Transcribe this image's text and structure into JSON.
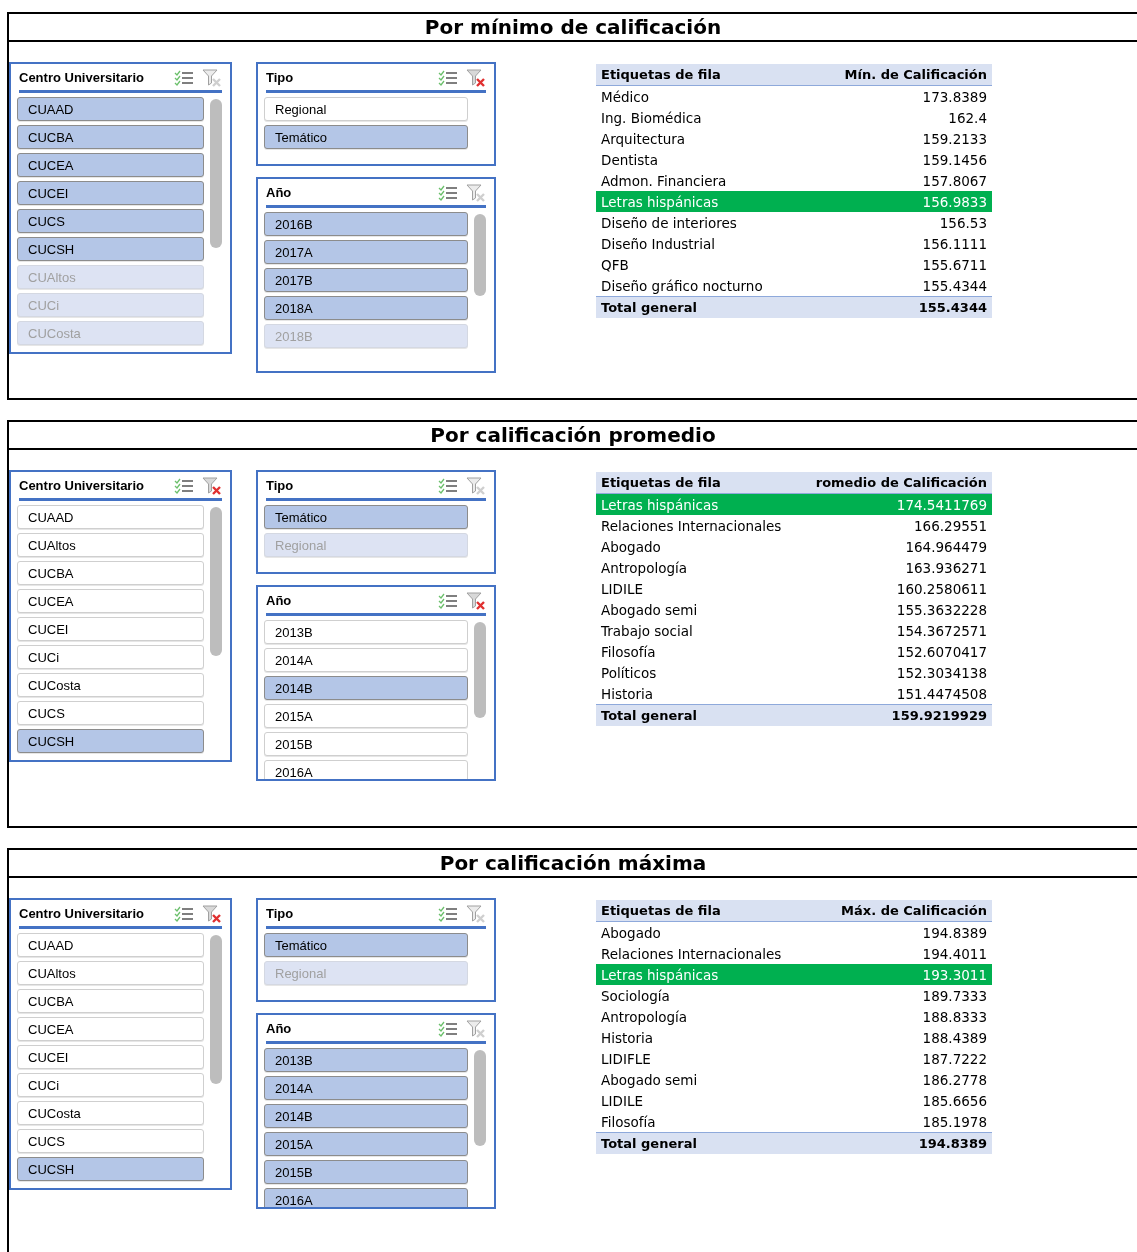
{
  "sections": [
    {
      "title": "Por mínimo de calificación",
      "slicers": [
        {
          "title": "Centro Universitario",
          "filter_active": false,
          "items": [
            {
              "label": "CUAAD",
              "selected": true,
              "disabled": false
            },
            {
              "label": "CUCBA",
              "selected": true,
              "disabled": false
            },
            {
              "label": "CUCEA",
              "selected": true,
              "disabled": false
            },
            {
              "label": "CUCEI",
              "selected": true,
              "disabled": false
            },
            {
              "label": "CUCS",
              "selected": true,
              "disabled": false
            },
            {
              "label": "CUCSH",
              "selected": true,
              "disabled": false
            },
            {
              "label": "CUAltos",
              "selected": true,
              "disabled": true
            },
            {
              "label": "CUCi",
              "selected": true,
              "disabled": true
            },
            {
              "label": "CUCosta",
              "selected": true,
              "disabled": true
            }
          ]
        },
        {
          "title": "Tipo",
          "filter_active": true,
          "items": [
            {
              "label": "Regional",
              "selected": false,
              "disabled": false
            },
            {
              "label": "Temático",
              "selected": true,
              "disabled": false
            }
          ]
        },
        {
          "title": "Año",
          "filter_active": false,
          "items": [
            {
              "label": "2016B",
              "selected": true,
              "disabled": false
            },
            {
              "label": "2017A",
              "selected": true,
              "disabled": false
            },
            {
              "label": "2017B",
              "selected": true,
              "disabled": false
            },
            {
              "label": "2018A",
              "selected": true,
              "disabled": false
            },
            {
              "label": "2018B",
              "selected": true,
              "disabled": true
            }
          ]
        }
      ],
      "table": {
        "columns": [
          "Etiquetas de fila",
          "Mín. de Calificación"
        ],
        "rows": [
          {
            "label": "Médico",
            "value": "173.8389",
            "highlighted": false
          },
          {
            "label": "Ing. Biomédica",
            "value": "162.4",
            "highlighted": false
          },
          {
            "label": "Arquitectura",
            "value": "159.2133",
            "highlighted": false
          },
          {
            "label": "Dentista",
            "value": "159.1456",
            "highlighted": false
          },
          {
            "label": "Admon. Financiera",
            "value": "157.8067",
            "highlighted": false
          },
          {
            "label": "Letras hispánicas",
            "value": "156.9833",
            "highlighted": true
          },
          {
            "label": "Diseño de interiores",
            "value": "156.53",
            "highlighted": false
          },
          {
            "label": "Diseño Industrial",
            "value": "156.1111",
            "highlighted": false
          },
          {
            "label": "QFB",
            "value": "155.6711",
            "highlighted": false
          },
          {
            "label": "Diseño gráfico nocturno",
            "value": "155.4344",
            "highlighted": false
          }
        ],
        "total": {
          "label": "Total general",
          "value": "155.4344"
        }
      }
    },
    {
      "title": "Por calificación promedio",
      "slicers": [
        {
          "title": "Centro Universitario",
          "filter_active": true,
          "items": [
            {
              "label": "CUAAD",
              "selected": false,
              "disabled": false
            },
            {
              "label": "CUAltos",
              "selected": false,
              "disabled": false
            },
            {
              "label": "CUCBA",
              "selected": false,
              "disabled": false
            },
            {
              "label": "CUCEA",
              "selected": false,
              "disabled": false
            },
            {
              "label": "CUCEI",
              "selected": false,
              "disabled": false
            },
            {
              "label": "CUCi",
              "selected": false,
              "disabled": false
            },
            {
              "label": "CUCosta",
              "selected": false,
              "disabled": false
            },
            {
              "label": "CUCS",
              "selected": false,
              "disabled": false
            },
            {
              "label": "CUCSH",
              "selected": true,
              "disabled": false
            }
          ]
        },
        {
          "title": "Tipo",
          "filter_active": false,
          "items": [
            {
              "label": "Temático",
              "selected": true,
              "disabled": false
            },
            {
              "label": "Regional",
              "selected": true,
              "disabled": true
            }
          ]
        },
        {
          "title": "Año",
          "filter_active": true,
          "items": [
            {
              "label": "2013B",
              "selected": false,
              "disabled": false
            },
            {
              "label": "2014A",
              "selected": false,
              "disabled": false
            },
            {
              "label": "2014B",
              "selected": true,
              "disabled": false
            },
            {
              "label": "2015A",
              "selected": false,
              "disabled": false
            },
            {
              "label": "2015B",
              "selected": false,
              "disabled": false
            },
            {
              "label": "2016A",
              "selected": false,
              "disabled": false
            }
          ]
        }
      ],
      "table": {
        "columns": [
          "Etiquetas de fila",
          "romedio de Calificación"
        ],
        "rows": [
          {
            "label": "Letras hispánicas",
            "value": "174.5411769",
            "highlighted": true
          },
          {
            "label": "Relaciones Internacionales",
            "value": "166.29551",
            "highlighted": false
          },
          {
            "label": "Abogado",
            "value": "164.964479",
            "highlighted": false
          },
          {
            "label": "Antropología",
            "value": "163.936271",
            "highlighted": false
          },
          {
            "label": "LIDILE",
            "value": "160.2580611",
            "highlighted": false
          },
          {
            "label": "Abogado semi",
            "value": "155.3632228",
            "highlighted": false
          },
          {
            "label": "Trabajo social",
            "value": "154.3672571",
            "highlighted": false
          },
          {
            "label": "Filosofía",
            "value": "152.6070417",
            "highlighted": false
          },
          {
            "label": "Políticos",
            "value": "152.3034138",
            "highlighted": false
          },
          {
            "label": "Historia",
            "value": "151.4474508",
            "highlighted": false
          }
        ],
        "total": {
          "label": "Total general",
          "value": "159.9219929"
        }
      }
    },
    {
      "title": "Por calificación máxima",
      "slicers": [
        {
          "title": "Centro Universitario",
          "filter_active": true,
          "items": [
            {
              "label": "CUAAD",
              "selected": false,
              "disabled": false
            },
            {
              "label": "CUAltos",
              "selected": false,
              "disabled": false
            },
            {
              "label": "CUCBA",
              "selected": false,
              "disabled": false
            },
            {
              "label": "CUCEA",
              "selected": false,
              "disabled": false
            },
            {
              "label": "CUCEI",
              "selected": false,
              "disabled": false
            },
            {
              "label": "CUCi",
              "selected": false,
              "disabled": false
            },
            {
              "label": "CUCosta",
              "selected": false,
              "disabled": false
            },
            {
              "label": "CUCS",
              "selected": false,
              "disabled": false
            },
            {
              "label": "CUCSH",
              "selected": true,
              "disabled": false
            }
          ]
        },
        {
          "title": "Tipo",
          "filter_active": false,
          "items": [
            {
              "label": "Temático",
              "selected": true,
              "disabled": false
            },
            {
              "label": "Regional",
              "selected": true,
              "disabled": true
            }
          ]
        },
        {
          "title": "Año",
          "filter_active": false,
          "items": [
            {
              "label": "2013B",
              "selected": true,
              "disabled": false
            },
            {
              "label": "2014A",
              "selected": true,
              "disabled": false
            },
            {
              "label": "2014B",
              "selected": true,
              "disabled": false
            },
            {
              "label": "2015A",
              "selected": true,
              "disabled": false
            },
            {
              "label": "2015B",
              "selected": true,
              "disabled": false
            },
            {
              "label": "2016A",
              "selected": true,
              "disabled": false
            }
          ]
        }
      ],
      "table": {
        "columns": [
          "Etiquetas de fila",
          "Máx. de Calificación"
        ],
        "rows": [
          {
            "label": "Abogado",
            "value": "194.8389",
            "highlighted": false
          },
          {
            "label": "Relaciones Internacionales",
            "value": "194.4011",
            "highlighted": false
          },
          {
            "label": "Letras hispánicas",
            "value": "193.3011",
            "highlighted": true
          },
          {
            "label": "Sociología",
            "value": "189.7333",
            "highlighted": false
          },
          {
            "label": "Antropología",
            "value": "188.8333",
            "highlighted": false
          },
          {
            "label": "Historia",
            "value": "188.4389",
            "highlighted": false
          },
          {
            "label": "LIDIFLE",
            "value": "187.7222",
            "highlighted": false
          },
          {
            "label": "Abogado semi",
            "value": "186.2778",
            "highlighted": false
          },
          {
            "label": "LIDILE",
            "value": "185.6656",
            "highlighted": false
          },
          {
            "label": "Filosofía",
            "value": "185.1978",
            "highlighted": false
          }
        ],
        "total": {
          "label": "Total general",
          "value": "194.8389"
        }
      }
    }
  ]
}
